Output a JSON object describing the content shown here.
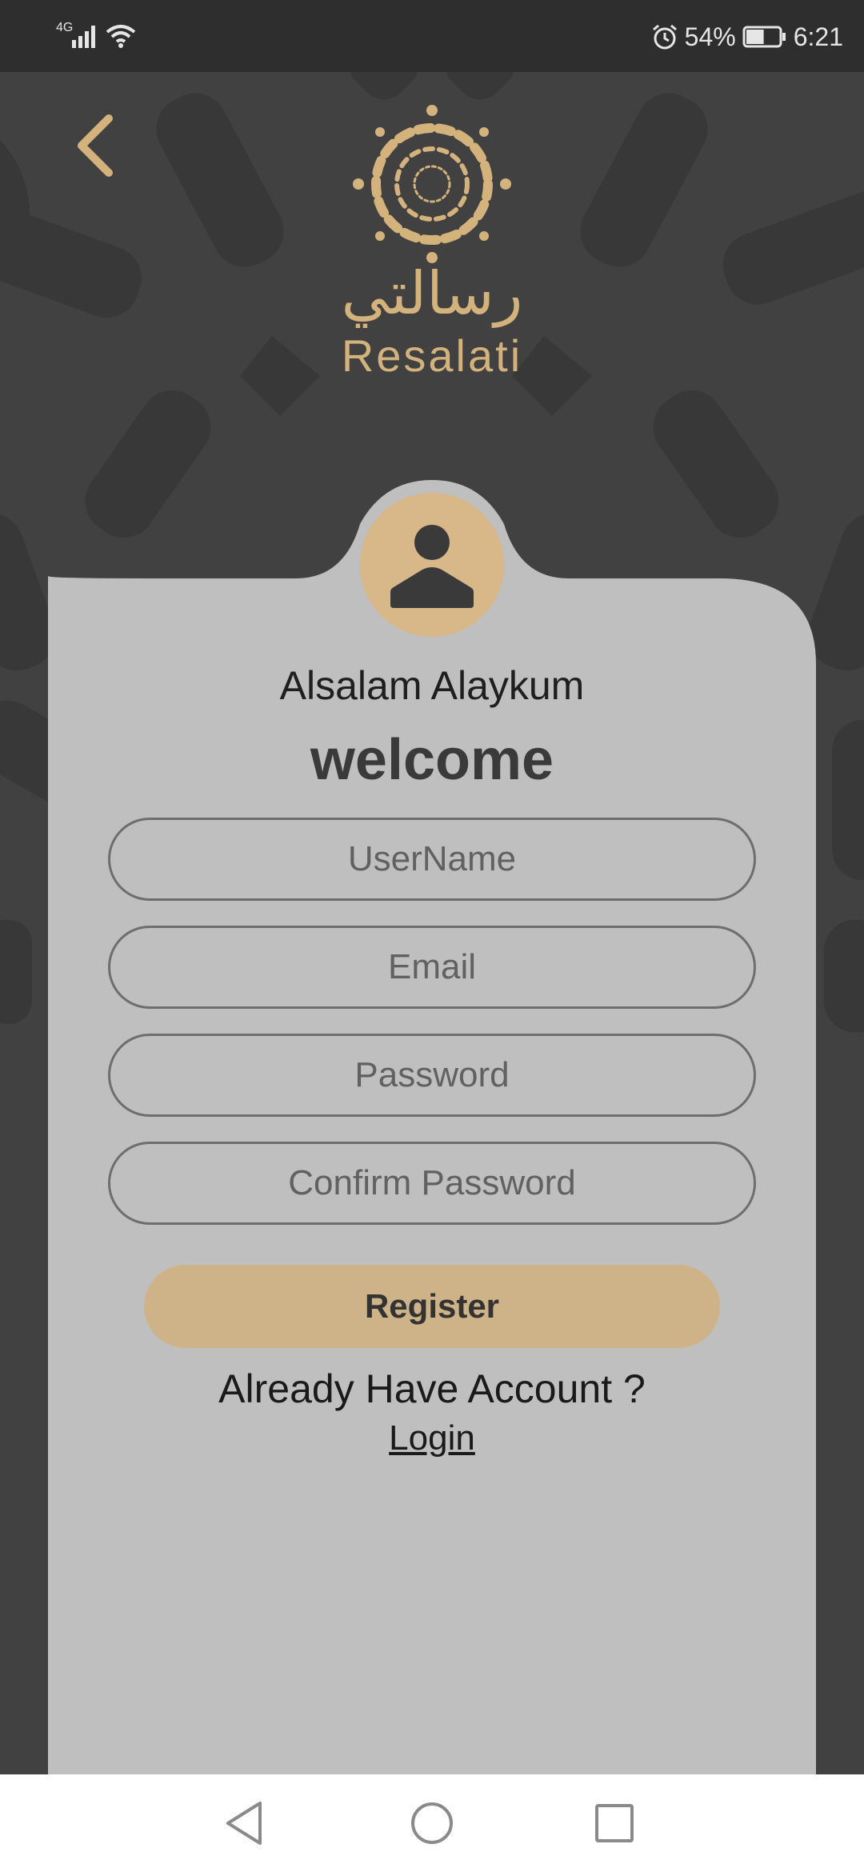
{
  "status_bar": {
    "network": "4G",
    "battery_percent": "54%",
    "time": "6:21",
    "battery_level": 0.54
  },
  "header": {
    "back_icon": "chevron-left-icon",
    "logo_icon": "mandala-logo-icon",
    "logo_arabic": "رسالتي",
    "logo_latin": "Resalati"
  },
  "form": {
    "avatar_icon": "user-icon",
    "greeting": "Alsalam Alaykum",
    "title": "welcome",
    "username_placeholder": "UserName",
    "email_placeholder": "Email",
    "password_placeholder": "Password",
    "confirm_password_placeholder": "Confirm Password",
    "register_label": "Register",
    "account_prompt": "Already Have Account ?",
    "login_label": "Login"
  },
  "nav_bar": {
    "back_icon": "triangle-back-icon",
    "home_icon": "circle-home-icon",
    "recents_icon": "square-recents-icon"
  },
  "colors": {
    "background": "#414141",
    "accent_gold": "#d4b27c",
    "card": "#bfbfbf",
    "button": "#ceb388"
  }
}
